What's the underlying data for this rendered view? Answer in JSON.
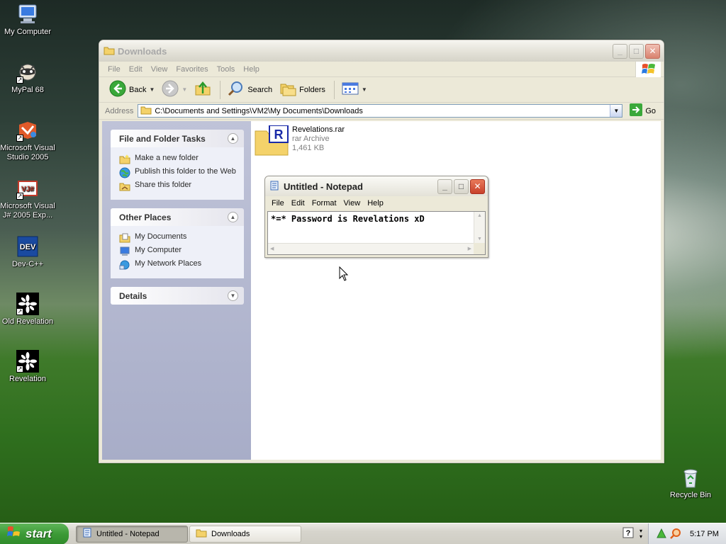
{
  "desktop": {
    "icons": [
      {
        "label": "My Computer"
      },
      {
        "label": "MyPal 68"
      },
      {
        "label": "Microsoft Visual Studio 2005"
      },
      {
        "label": "Microsoft Visual J# 2005 Exp..."
      },
      {
        "label": "Dev-C++"
      },
      {
        "label": "Old Revelation"
      },
      {
        "label": "Revelation"
      },
      {
        "label": "Recycle Bin"
      }
    ],
    "dev_badge": "DEV",
    "vj_badge": "VJ#"
  },
  "explorer": {
    "title": "Downloads",
    "menu": [
      "File",
      "Edit",
      "View",
      "Favorites",
      "Tools",
      "Help"
    ],
    "toolbar": {
      "back_label": "Back",
      "search_label": "Search",
      "folders_label": "Folders"
    },
    "address": {
      "label": "Address",
      "path": "C:\\Documents and Settings\\VM2\\My Documents\\Downloads",
      "go_label": "Go"
    },
    "taskpane": {
      "file_tasks": {
        "title": "File and Folder Tasks",
        "items": [
          "Make a new folder",
          "Publish this folder to the Web",
          "Share this folder"
        ]
      },
      "other_places": {
        "title": "Other Places",
        "items": [
          "My Documents",
          "My Computer",
          "My Network Places"
        ]
      },
      "details": {
        "title": "Details"
      }
    },
    "files": [
      {
        "name": "Revelations.rar",
        "type": "rar Archive",
        "size": "1,461 KB",
        "badge": "R"
      }
    ]
  },
  "notepad": {
    "title": "Untitled - Notepad",
    "menu": [
      "File",
      "Edit",
      "Format",
      "View",
      "Help"
    ],
    "content": "*=* Password is Revelations xD"
  },
  "taskbar": {
    "start_label": "start",
    "tasks": [
      {
        "label": "Untitled - Notepad",
        "active": true
      },
      {
        "label": "Downloads",
        "active": false
      }
    ],
    "clock": "5:17 PM"
  },
  "colors": {
    "start_green": "#3c9a36",
    "close_red": "#d9826e",
    "taskpane_blue": "#a8adc8"
  }
}
